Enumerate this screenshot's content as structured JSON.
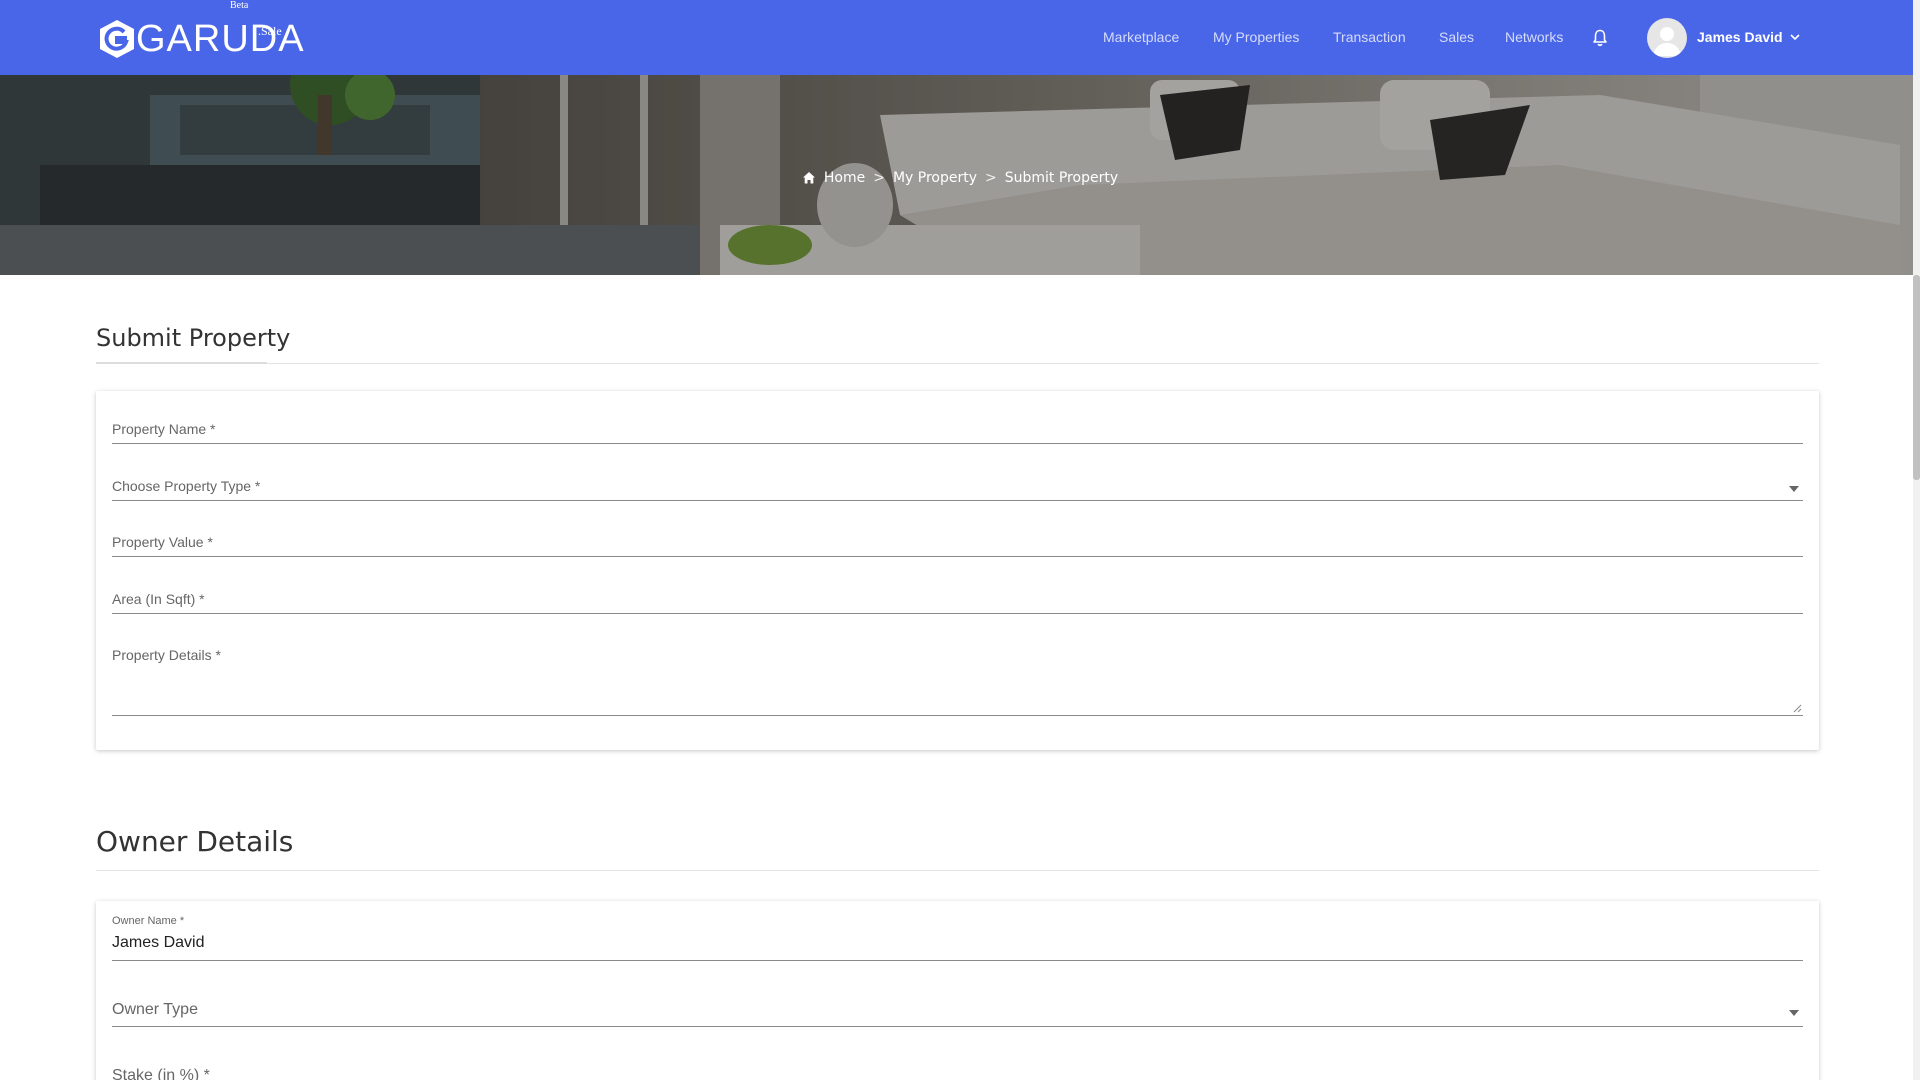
{
  "brand": {
    "logo_text": "GARUDA",
    "beta": "Beta",
    "sale": ".Sale"
  },
  "colors": {
    "header_bg": "#4a66e8",
    "nav_text": "#d5dcfb"
  },
  "nav": {
    "items": [
      "Marketplace",
      "My Properties",
      "Transaction",
      "Sales",
      "Networks"
    ],
    "notification_icon": "bell-icon",
    "user_name": "James David",
    "user_menu_icon": "chevron-down-icon"
  },
  "breadcrumb": {
    "home": "Home",
    "sep1": ">",
    "middle": "My Property",
    "sep2": ">",
    "current": "Submit Property"
  },
  "submit_section": {
    "title": "Submit Property",
    "fields": {
      "property_name": "Property Name *",
      "property_type": "Choose Property Type *",
      "property_value": "Property Value *",
      "area": "Area (In Sqft) *",
      "property_details": "Property Details *"
    }
  },
  "owner_section": {
    "title": "Owner Details",
    "owner_name_label": "Owner Name *",
    "owner_name_value": "James David",
    "owner_type": "Owner Type",
    "stake": "Stake (in %) *"
  }
}
